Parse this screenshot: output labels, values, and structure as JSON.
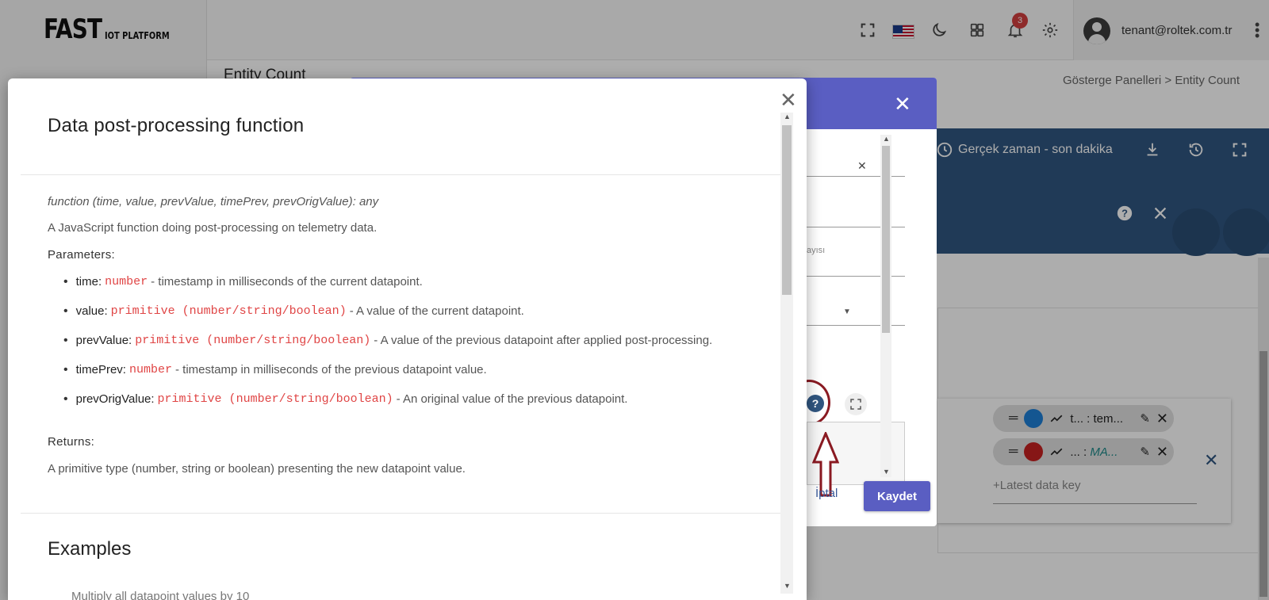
{
  "app": {
    "logo_main": "FAST",
    "logo_sub": "IOT PLATFORM",
    "notification_count": "3",
    "user_email": "tenant@roltek.com.tr"
  },
  "page": {
    "title": "Entity Count",
    "breadcrumb": "Gösterge Panelleri  >  Entity Count"
  },
  "toolbar": {
    "realtime_label": "Gerçek zaman - son dakika"
  },
  "keys": {
    "chips": [
      {
        "label": "t... : tem...",
        "label_prefix": "",
        "color": "#1e7fd6"
      },
      {
        "label_prefix": "... : ",
        "label": "MA...",
        "color": "#c62121"
      }
    ],
    "latest_placeholder": "+Latest data key"
  },
  "mid_dialog": {
    "hint": "ayısı",
    "cancel_label": "İptal",
    "save_label": "Kaydet",
    "help_glyph": "?"
  },
  "help_dialog": {
    "title": "Data post-processing function",
    "signature": "function (time, value, prevValue, timePrev, prevOrigValue): any",
    "description": "A JavaScript function doing post-processing on telemetry data.",
    "params_heading": "Parameters:",
    "params": [
      {
        "name": "time:",
        "type": "number",
        "desc": "- timestamp in milliseconds of the current datapoint."
      },
      {
        "name": "value:",
        "type": "primitive (number/string/boolean)",
        "desc": "- A value of the current datapoint."
      },
      {
        "name": "prevValue:",
        "type": "primitive (number/string/boolean)",
        "desc": "- A value of the previous datapoint after applied post-processing."
      },
      {
        "name": "timePrev:",
        "type": "number",
        "desc": "- timestamp in milliseconds of the previous datapoint value."
      },
      {
        "name": "prevOrigValue:",
        "type": "primitive (number/string/boolean)",
        "desc": "- An original value of the previous datapoint."
      }
    ],
    "returns_heading": "Returns:",
    "returns_text": "A primitive type (number, string or boolean) presenting the new datapoint value.",
    "examples_heading": "Examples",
    "examples_cut": "Multiply all datapoint values by 10"
  }
}
